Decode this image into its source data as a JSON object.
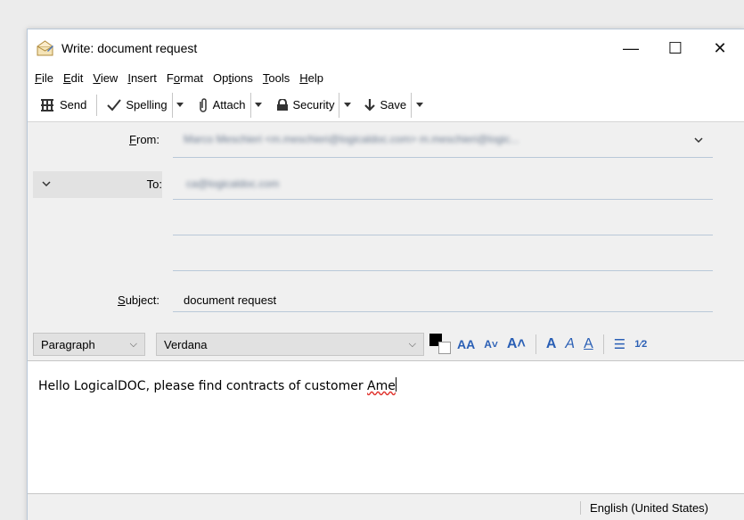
{
  "window": {
    "title": "Write: document request",
    "controls": {
      "minimize": "—",
      "maximize": "☐",
      "close": "✕"
    }
  },
  "menu": [
    {
      "label": "File",
      "accel": "F",
      "rest": "ile"
    },
    {
      "label": "Edit",
      "accel": "E",
      "rest": "dit"
    },
    {
      "label": "View",
      "accel": "V",
      "rest": "iew"
    },
    {
      "label": "Insert",
      "accel": "I",
      "rest": "nsert"
    },
    {
      "label": "Format",
      "pre": "F",
      "accel": "o",
      "rest": "rmat"
    },
    {
      "label": "Options",
      "pre": "Op",
      "accel": "t",
      "rest": "ions"
    },
    {
      "label": "Tools",
      "accel": "T",
      "rest": "ools"
    },
    {
      "label": "Help",
      "accel": "H",
      "rest": "elp"
    }
  ],
  "toolbar": {
    "send": "Send",
    "spelling": "Spelling",
    "attach": "Attach",
    "security": "Security",
    "save": "Save"
  },
  "headers": {
    "from_label": "From:",
    "from_value": "Marco Meschieri <m.meschieri@logicaldoc.com>  m.meschieri@logic...",
    "to_label": "To:",
    "to_value": "ca@logicaldoc.com",
    "subject_label": "Subject:",
    "subject_value": "document request"
  },
  "format_bar": {
    "paragraph": "Paragraph",
    "font": "Verdana",
    "text_color": "#000000"
  },
  "editor": {
    "text_before": "Hello LogicalDOC, please find contracts of customer ",
    "misspelled_word": "Ame"
  },
  "status": {
    "language": "English (United States)"
  }
}
